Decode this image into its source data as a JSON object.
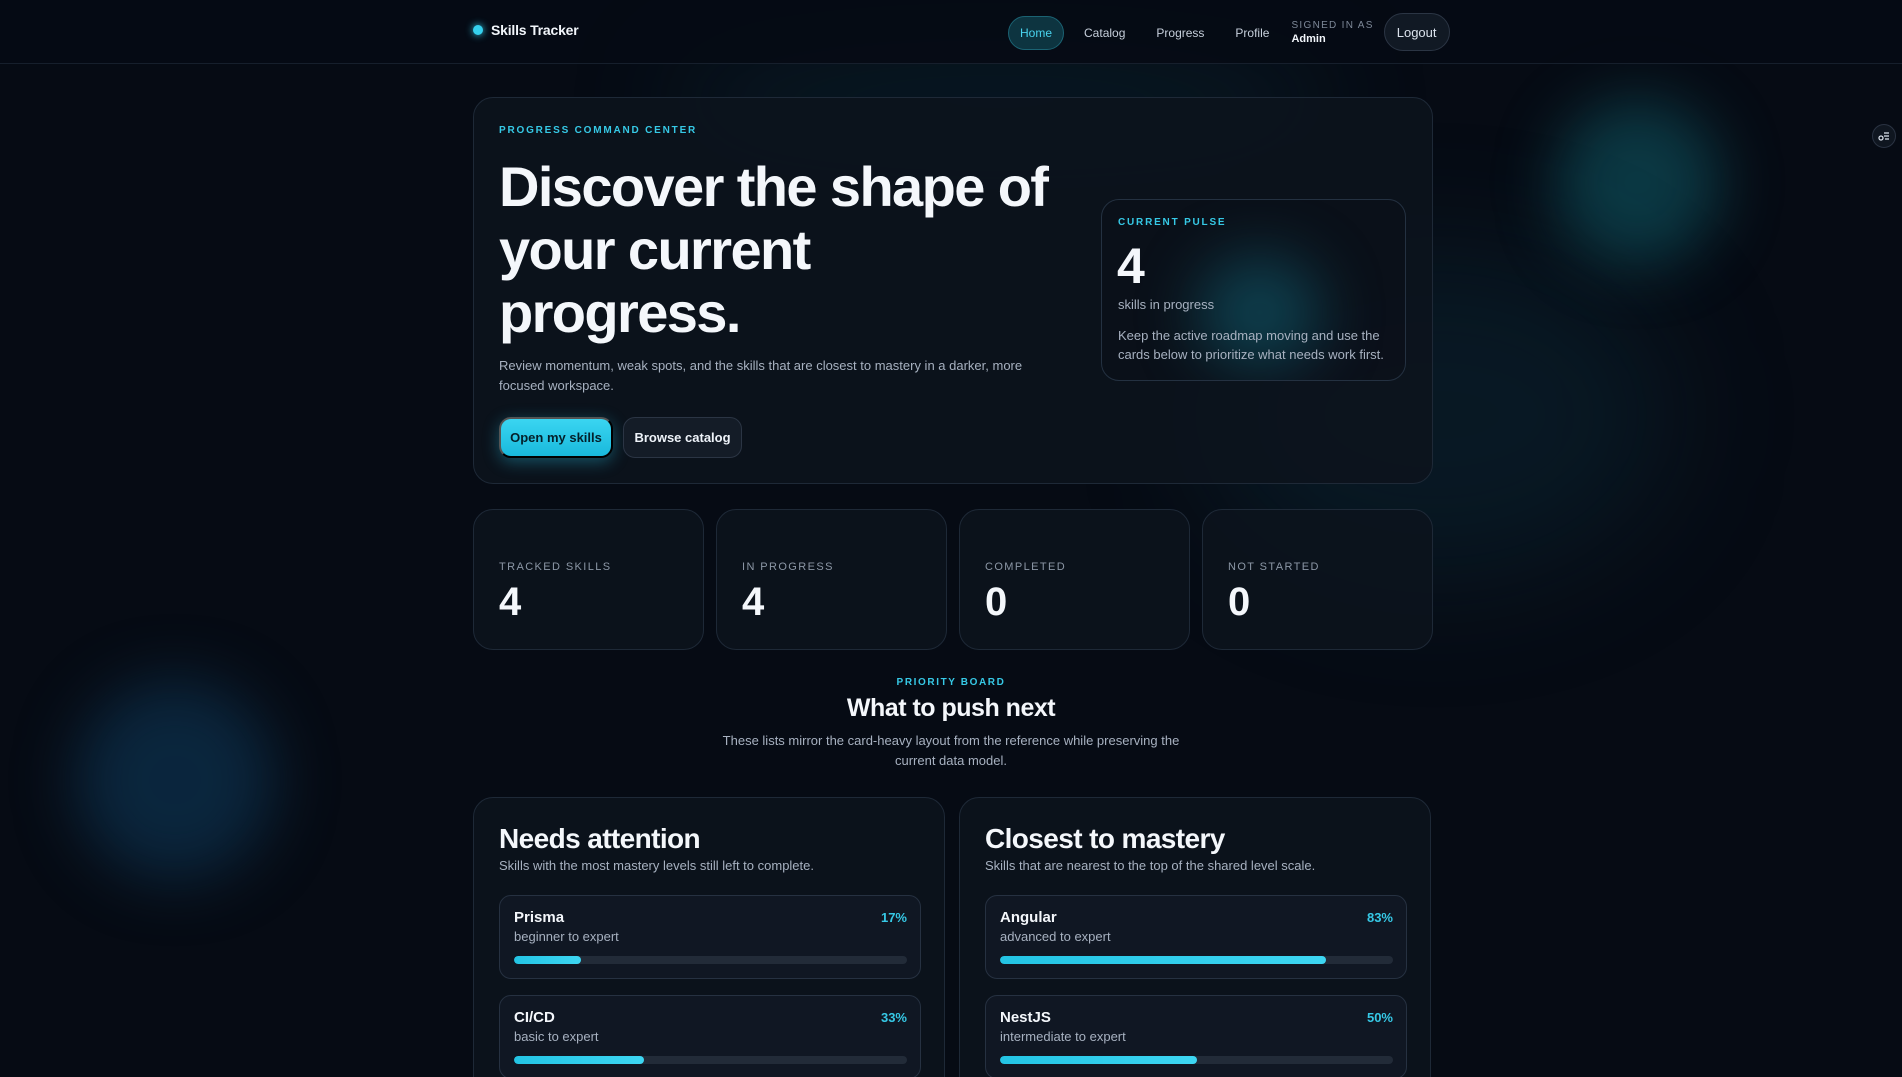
{
  "app": {
    "name": "Skills Tracker"
  },
  "nav": {
    "items": [
      {
        "label": "Home",
        "active": true
      },
      {
        "label": "Catalog",
        "active": false
      },
      {
        "label": "Progress",
        "active": false
      },
      {
        "label": "Profile",
        "active": false
      }
    ],
    "signed_in_label": "SIGNED IN AS",
    "signed_in_user": "Admin",
    "logout_label": "Logout"
  },
  "hero": {
    "eyebrow": "PROGRESS COMMAND CENTER",
    "title": "Discover the shape of your current progress.",
    "description": "Review momentum, weak spots, and the skills that are closest to mastery in a darker, more focused workspace.",
    "primary_button": "Open my skills",
    "secondary_button": "Browse catalog",
    "pulse": {
      "eyebrow": "CURRENT PULSE",
      "value": "4",
      "label": "skills in progress",
      "description": "Keep the active roadmap moving and use the cards below to prioritize what needs work first."
    }
  },
  "stats": [
    {
      "label": "TRACKED SKILLS",
      "value": "4"
    },
    {
      "label": "IN PROGRESS",
      "value": "4"
    },
    {
      "label": "COMPLETED",
      "value": "0"
    },
    {
      "label": "NOT STARTED",
      "value": "0"
    }
  ],
  "priority": {
    "eyebrow": "PRIORITY BOARD",
    "title": "What to push next",
    "description": "These lists mirror the card-heavy layout from the reference while preserving the current data model."
  },
  "panels": [
    {
      "title": "Needs attention",
      "description": "Skills with the most mastery levels still left to complete.",
      "skills": [
        {
          "name": "Prisma",
          "range": "beginner to expert",
          "percent_label": "17%",
          "progress": 0.17
        },
        {
          "name": "CI/CD",
          "range": "basic to expert",
          "percent_label": "33%",
          "progress": 0.33
        }
      ]
    },
    {
      "title": "Closest to mastery",
      "description": "Skills that are nearest to the top of the shared level scale.",
      "skills": [
        {
          "name": "Angular",
          "range": "advanced to expert",
          "percent_label": "83%",
          "progress": 0.83
        },
        {
          "name": "NestJS",
          "range": "intermediate to expert",
          "percent_label": "50%",
          "progress": 0.5
        }
      ]
    }
  ],
  "colors": {
    "accent": "#36c9e6",
    "background": "#060b14",
    "card": "#0d131d"
  }
}
